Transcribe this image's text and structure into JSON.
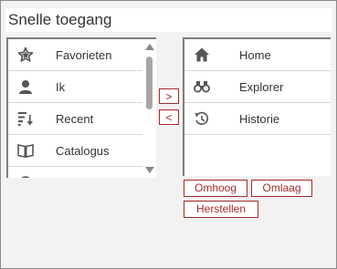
{
  "title": "Snelle toegang",
  "available": [
    {
      "label": "Favorieten",
      "icon": "star-icon"
    },
    {
      "label": "Ik",
      "icon": "person-icon"
    },
    {
      "label": "Recent",
      "icon": "recent-sort-icon"
    },
    {
      "label": "Catalogus",
      "icon": "book-icon"
    }
  ],
  "selected": [
    {
      "label": "Home",
      "icon": "home-icon"
    },
    {
      "label": "Explorer",
      "icon": "binoculars-icon"
    },
    {
      "label": "Historie",
      "icon": "history-icon"
    }
  ],
  "move_right_label": ">",
  "move_left_label": "<",
  "buttons": {
    "up": "Omhoog",
    "down": "Omlaag",
    "reset": "Herstellen"
  },
  "colors": {
    "accent": "#a52a2a",
    "icon": "#555555"
  }
}
